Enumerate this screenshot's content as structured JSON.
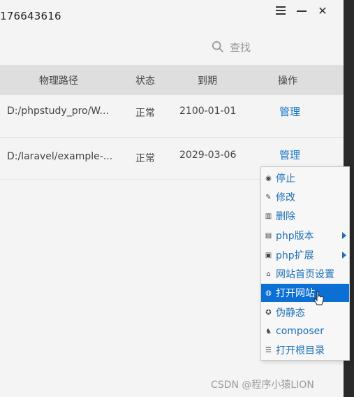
{
  "window": {
    "title_id": "176643616"
  },
  "search": {
    "label": "查找",
    "icon": "search-icon"
  },
  "table": {
    "headers": [
      "物理路径",
      "状态",
      "到期",
      "操作"
    ],
    "rows": [
      {
        "path": "D:/phpstudy_pro/W...",
        "status": "正常",
        "expire": "2100-01-01",
        "action": "管理"
      },
      {
        "path": "D:/laravel/example-...",
        "status": "正常",
        "expire": "2029-03-06",
        "action": "管理"
      }
    ]
  },
  "context_menu": {
    "items": [
      {
        "label": "停止",
        "icon": "stop-icon",
        "submenu": false
      },
      {
        "label": "修改",
        "icon": "edit-icon",
        "submenu": false
      },
      {
        "label": "删除",
        "icon": "trash-icon",
        "submenu": false
      },
      {
        "label": "php版本",
        "icon": "php-version-icon",
        "submenu": true
      },
      {
        "label": "php扩展",
        "icon": "php-extension-icon",
        "submenu": true
      },
      {
        "label": "网站首页设置",
        "icon": "home-icon",
        "submenu": false
      },
      {
        "label": "打开网站",
        "icon": "globe-icon",
        "submenu": false,
        "active": true
      },
      {
        "label": "伪静态",
        "icon": "rewrite-icon",
        "submenu": false
      },
      {
        "label": "composer",
        "icon": "composer-icon",
        "submenu": false
      },
      {
        "label": "打开根目录",
        "icon": "folder-list-icon",
        "submenu": false
      }
    ]
  },
  "watermark": "CSDN @程序小猿LION",
  "colors": {
    "link": "#1677c9",
    "menu_active": "#0b6fd4"
  }
}
